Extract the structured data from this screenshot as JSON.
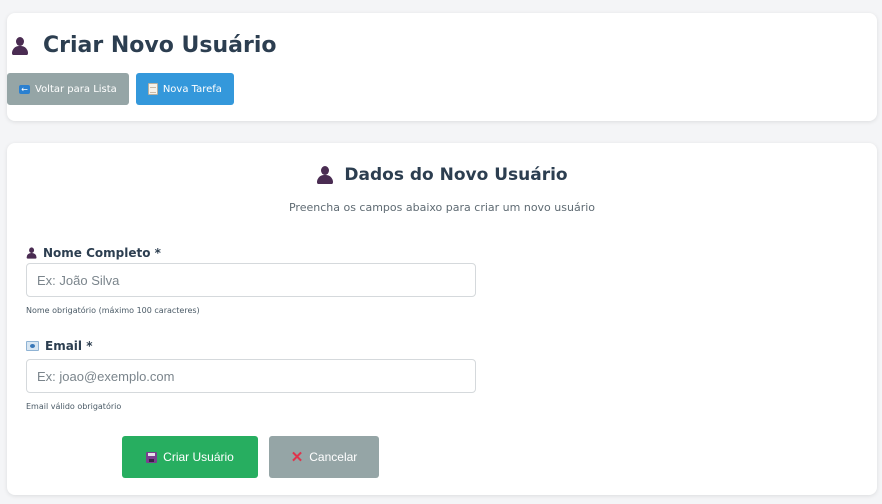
{
  "header": {
    "title": "Criar Novo Usuário",
    "back_button": "Voltar para Lista",
    "new_task_button": "Nova Tarefa"
  },
  "form": {
    "title": "Dados do Novo Usuário",
    "subtitle": "Preencha os campos abaixo para criar um novo usuário",
    "name_field": {
      "label": "Nome Completo *",
      "placeholder": "Ex: João Silva",
      "value": "",
      "help": "Nome obrigatório (máximo 100 caracteres)"
    },
    "email_field": {
      "label": "Email *",
      "placeholder": "Ex: joao@exemplo.com",
      "value": "",
      "help": "Email válido obrigatório"
    },
    "submit_button": "Criar Usuário",
    "cancel_button": "Cancelar"
  },
  "icons": {
    "title": "user-icon",
    "back": "back-arrow-icon",
    "new_task": "notepad-icon",
    "email": "id-card-icon",
    "submit": "floppy-disk-icon",
    "cancel": "cross-mark-icon"
  },
  "colors": {
    "primary_text": "#2c3e50",
    "gray_button": "#95a5a6",
    "blue_button": "#3498db",
    "green_button": "#27ae60",
    "cancel_x": "#e0344c"
  }
}
